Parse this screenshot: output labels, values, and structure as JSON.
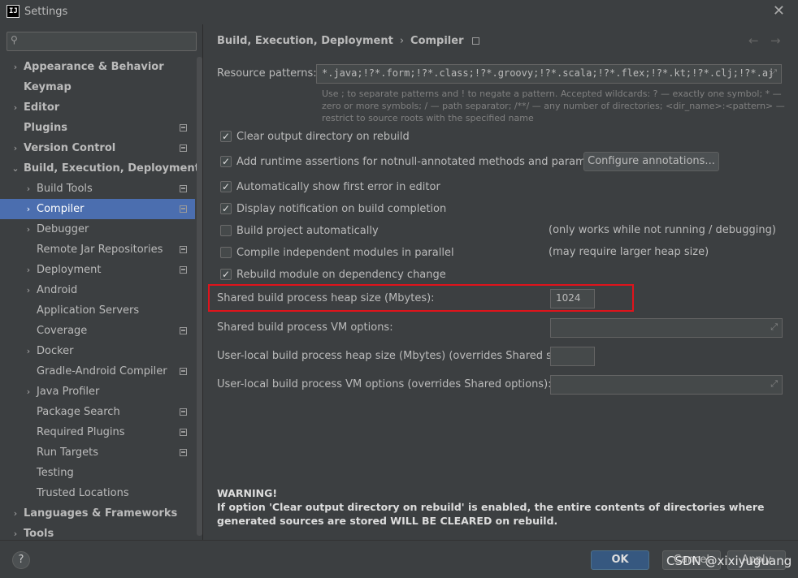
{
  "window": {
    "title": "Settings",
    "app_icon_text": "IJ"
  },
  "search": {
    "placeholder": "",
    "value": ""
  },
  "sidebar": {
    "items": [
      {
        "label": "Appearance & Behavior",
        "level": 0,
        "arrow": "›",
        "bold": true
      },
      {
        "label": "Keymap",
        "level": 0,
        "arrow": "",
        "bold": true
      },
      {
        "label": "Editor",
        "level": 0,
        "arrow": "›",
        "bold": true
      },
      {
        "label": "Plugins",
        "level": 0,
        "arrow": "",
        "bold": true,
        "icon": true
      },
      {
        "label": "Version Control",
        "level": 0,
        "arrow": "›",
        "bold": true,
        "icon": true
      },
      {
        "label": "Build, Execution, Deployment",
        "level": 0,
        "arrow": "⌄",
        "bold": true
      },
      {
        "label": "Build Tools",
        "level": 1,
        "arrow": "›",
        "icon": true
      },
      {
        "label": "Compiler",
        "level": 1,
        "arrow": "›",
        "icon": true,
        "selected": true
      },
      {
        "label": "Debugger",
        "level": 1,
        "arrow": "›"
      },
      {
        "label": "Remote Jar Repositories",
        "level": 1,
        "arrow": "",
        "icon": true
      },
      {
        "label": "Deployment",
        "level": 1,
        "arrow": "›",
        "icon": true
      },
      {
        "label": "Android",
        "level": 1,
        "arrow": "›"
      },
      {
        "label": "Application Servers",
        "level": 1,
        "arrow": ""
      },
      {
        "label": "Coverage",
        "level": 1,
        "arrow": "",
        "icon": true
      },
      {
        "label": "Docker",
        "level": 1,
        "arrow": "›"
      },
      {
        "label": "Gradle-Android Compiler",
        "level": 1,
        "arrow": "",
        "icon": true
      },
      {
        "label": "Java Profiler",
        "level": 1,
        "arrow": "›"
      },
      {
        "label": "Package Search",
        "level": 1,
        "arrow": "",
        "icon": true
      },
      {
        "label": "Required Plugins",
        "level": 1,
        "arrow": "",
        "icon": true
      },
      {
        "label": "Run Targets",
        "level": 1,
        "arrow": "",
        "icon": true
      },
      {
        "label": "Testing",
        "level": 1,
        "arrow": ""
      },
      {
        "label": "Trusted Locations",
        "level": 1,
        "arrow": ""
      },
      {
        "label": "Languages & Frameworks",
        "level": 0,
        "arrow": "›",
        "bold": true
      },
      {
        "label": "Tools",
        "level": 0,
        "arrow": "›",
        "bold": true
      }
    ]
  },
  "breadcrumb": {
    "parent": "Build, Execution, Deployment",
    "separator": "›",
    "current": "Compiler"
  },
  "nav": {
    "back": "←",
    "forward": "→"
  },
  "resource_patterns": {
    "label": "Resource patterns:",
    "value": "*.java;!?*.form;!?*.class;!?*.groovy;!?*.scala;!?*.flex;!?*.kt;!?*.clj;!?*.aj",
    "hint": "Use ; to separate patterns and ! to negate a pattern. Accepted wildcards: ? — exactly one symbol; * — zero or more symbols; / — path separator; /**/ — any number of directories; <dir_name>:<pattern> — restrict to source roots with the specified name"
  },
  "options": {
    "clear_output": {
      "label": "Clear output directory on rebuild",
      "checked": true
    },
    "runtime_assertions": {
      "label": "Add runtime assertions for notnull-annotated methods and parameters",
      "checked": true
    },
    "show_first_error": {
      "label": "Automatically show first error in editor",
      "checked": true
    },
    "display_notification": {
      "label": "Display notification on build completion",
      "checked": true
    },
    "build_auto": {
      "label": "Build project automatically",
      "checked": false,
      "note": "(only works while not running / debugging)"
    },
    "compile_parallel": {
      "label": "Compile independent modules in parallel",
      "checked": false,
      "note": "(may require larger heap size)"
    },
    "rebuild_dependency": {
      "label": "Rebuild module on dependency change",
      "checked": true
    }
  },
  "configure_annotations_button": "Configure annotations...",
  "heap": {
    "label": "Shared build process heap size (Mbytes):",
    "value": "1024"
  },
  "vm_options": {
    "label": "Shared build process VM options:",
    "value": ""
  },
  "user_heap": {
    "label": "User-local build process heap size (Mbytes) (overrides Shared size):",
    "value": ""
  },
  "user_vm": {
    "label": "User-local build process VM options (overrides Shared options):",
    "value": ""
  },
  "warning": {
    "title": "WARNING!",
    "text": "If option 'Clear output directory on rebuild' is enabled, the entire contents of directories where generated sources are stored WILL BE CLEARED on rebuild."
  },
  "footer": {
    "help": "?",
    "ok": "OK",
    "cancel": "Cancel",
    "apply": "Apply"
  },
  "watermark": "CSDN @xixiyuguang",
  "colors": {
    "selection": "#4b6eaf",
    "highlight_border": "#e0131b",
    "ok_button": "#365880"
  }
}
